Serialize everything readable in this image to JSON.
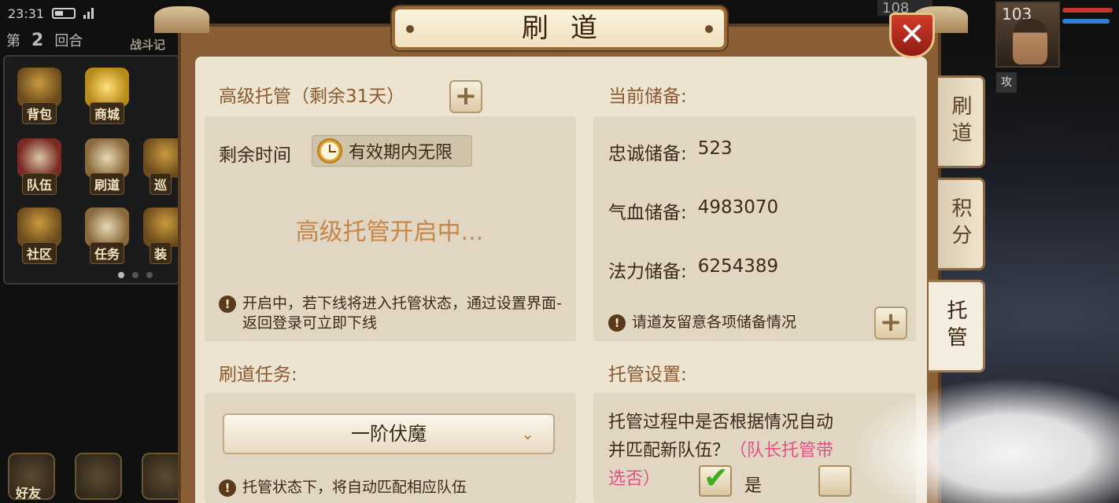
{
  "status_bar": {
    "time": "23:31"
  },
  "round": {
    "prefix": "第",
    "number": "2",
    "suffix": "回合"
  },
  "battle_log_label": "战斗记",
  "menu": {
    "items": [
      {
        "label": "背包",
        "icon": "bag-icon"
      },
      {
        "label": "商城",
        "icon": "gold-ingot-icon"
      },
      {
        "label": "队伍",
        "icon": "team-flag-icon"
      },
      {
        "label": "刷道",
        "icon": "scroll-icon"
      },
      {
        "label": "巡",
        "icon": "patrol-icon"
      },
      {
        "label": "社区",
        "icon": "community-icon"
      },
      {
        "label": "任务",
        "icon": "quest-scroll-icon"
      },
      {
        "label": "装",
        "icon": "equipment-icon"
      }
    ]
  },
  "bottom_bar": {
    "friends_label": "好友"
  },
  "player": {
    "level": "103",
    "tag": "攻"
  },
  "enemy": {
    "level": "108"
  },
  "dialog": {
    "title": "刷道",
    "close_label": "✕",
    "tabs": [
      {
        "label": "刷道"
      },
      {
        "label": "积分"
      },
      {
        "label": "托管"
      }
    ],
    "advanced": {
      "heading": "高级托管（剩余31天）",
      "add_label": "+",
      "remaining_label": "剩余时间",
      "remaining_value": "有效期内无限",
      "status": "高级托管开启中...",
      "note": "开启中，若下线将进入托管状态，通过设置界面-返回登录可立即下线"
    },
    "reserves": {
      "heading": "当前储备:",
      "rows": [
        {
          "label": "忠诚储备:",
          "value": "523"
        },
        {
          "label": "气血储备:",
          "value": "4983070"
        },
        {
          "label": "法力储备:",
          "value": "6254389"
        }
      ],
      "note": "请道友留意各项储备情况",
      "add_label": "+"
    },
    "task": {
      "heading": "刷道任务:",
      "selected": "一阶伏魔",
      "note": "托管状态下，将自动匹配相应队伍"
    },
    "settings": {
      "heading": "托管设置:",
      "question_line1": "托管过程中是否根据情况自动",
      "question_line2": "并匹配新队伍？",
      "pink_text": "（队长托管带",
      "pink_text2": "选否）",
      "yes_label": "是",
      "yes_checked": true
    }
  },
  "colors": {
    "panel_bg": "#ece3d0",
    "frame": "#8a5f35",
    "accent_text": "#c6864a",
    "pink": "#e0518a",
    "check_green": "#3fae1e"
  }
}
